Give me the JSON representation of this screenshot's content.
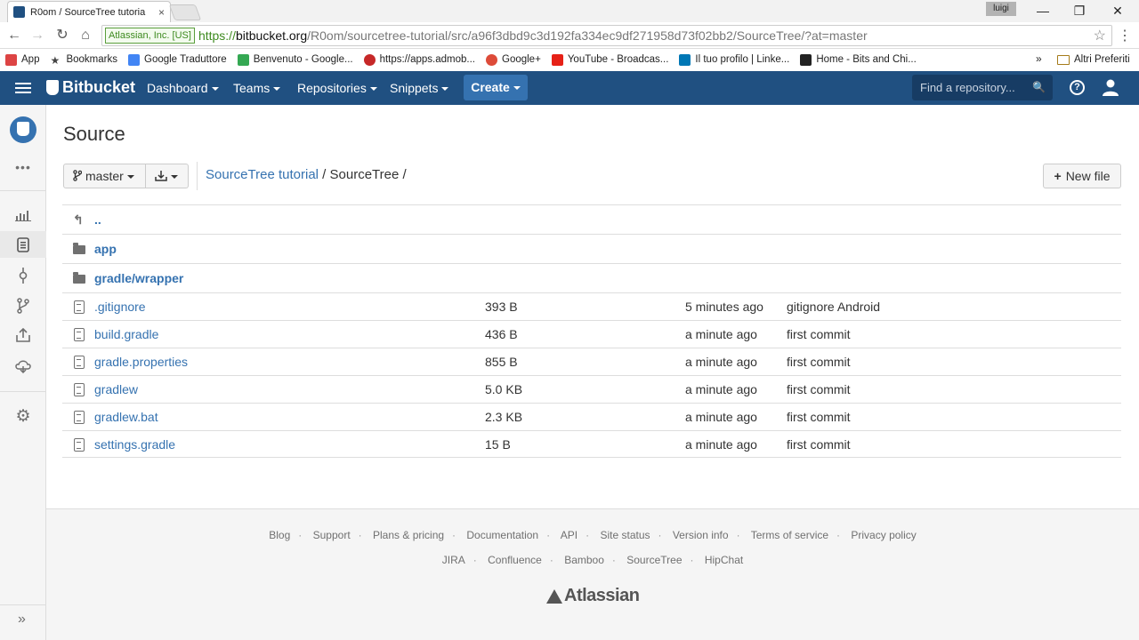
{
  "browser": {
    "tab_title": "R0om / SourceTree tutoria",
    "tab_close": "×",
    "user_chip": "luigi",
    "window_controls": [
      "—",
      "❐",
      "✕"
    ],
    "secure_label": "Atlassian, Inc. [US]",
    "url_scheme": "https://",
    "url_host": "bitbucket.org",
    "url_path": "/R0om/sourcetree-tutorial/src/a96f3dbd9c3d192fa334ec9df271958d73f02bb2/SourceTree/?at=master",
    "bookmarks": [
      {
        "label": "App",
        "icon": "apps-grid-icon",
        "color": "#d44"
      },
      {
        "label": "Bookmarks",
        "icon": "star-icon",
        "color": "#444"
      },
      {
        "label": "Google Traduttore",
        "icon": "google-translate-icon",
        "color": "#4285f4"
      },
      {
        "label": "Benvenuto - Google...",
        "icon": "google-play-icon",
        "color": "#34a853"
      },
      {
        "label": "https://apps.admob...",
        "icon": "admob-icon",
        "color": "#c62828"
      },
      {
        "label": "Google+",
        "icon": "google-plus-icon",
        "color": "#dd4b39"
      },
      {
        "label": "YouTube - Broadcas...",
        "icon": "youtube-icon",
        "color": "#e62117"
      },
      {
        "label": "Il tuo profilo | Linke...",
        "icon": "linkedin-icon",
        "color": "#0077b5"
      },
      {
        "label": "Home - Bits and Chi...",
        "icon": "bits-and-chips-icon",
        "color": "#222"
      }
    ],
    "bookmarks_more": "»",
    "other_bookmarks": "Altri Preferiti"
  },
  "header": {
    "logo": "Bitbucket",
    "nav": [
      "Dashboard",
      "Teams",
      "Repositories",
      "Snippets"
    ],
    "create": "Create",
    "search_placeholder": "Find a repository..."
  },
  "page": {
    "title": "Source",
    "branch": "master",
    "breadcrumb_repo": "SourceTree tutorial",
    "breadcrumb_sep": " / ",
    "breadcrumb_dir": "SourceTree /",
    "new_file": "New file",
    "parent_link": ".."
  },
  "folders": [
    {
      "name": "app"
    },
    {
      "name": "gradle/wrapper"
    }
  ],
  "files": [
    {
      "name": ".gitignore",
      "size": "393 B",
      "age": "5 minutes ago",
      "message": "gitignore Android"
    },
    {
      "name": "build.gradle",
      "size": "436 B",
      "age": "a minute ago",
      "message": "first commit"
    },
    {
      "name": "gradle.properties",
      "size": "855 B",
      "age": "a minute ago",
      "message": "first commit"
    },
    {
      "name": "gradlew",
      "size": "5.0 KB",
      "age": "a minute ago",
      "message": "first commit"
    },
    {
      "name": "gradlew.bat",
      "size": "2.3 KB",
      "age": "a minute ago",
      "message": "first commit"
    },
    {
      "name": "settings.gradle",
      "size": "15 B",
      "age": "a minute ago",
      "message": "first commit"
    }
  ],
  "footer": {
    "links_row1": [
      "Blog",
      "Support",
      "Plans & pricing",
      "Documentation",
      "API",
      "Site status",
      "Version info",
      "Terms of service",
      "Privacy policy"
    ],
    "links_row2": [
      "JIRA",
      "Confluence",
      "Bamboo",
      "SourceTree",
      "HipChat"
    ],
    "logo": "Atlassian"
  },
  "colors": {
    "brand": "#205081",
    "link": "#3572b0"
  }
}
